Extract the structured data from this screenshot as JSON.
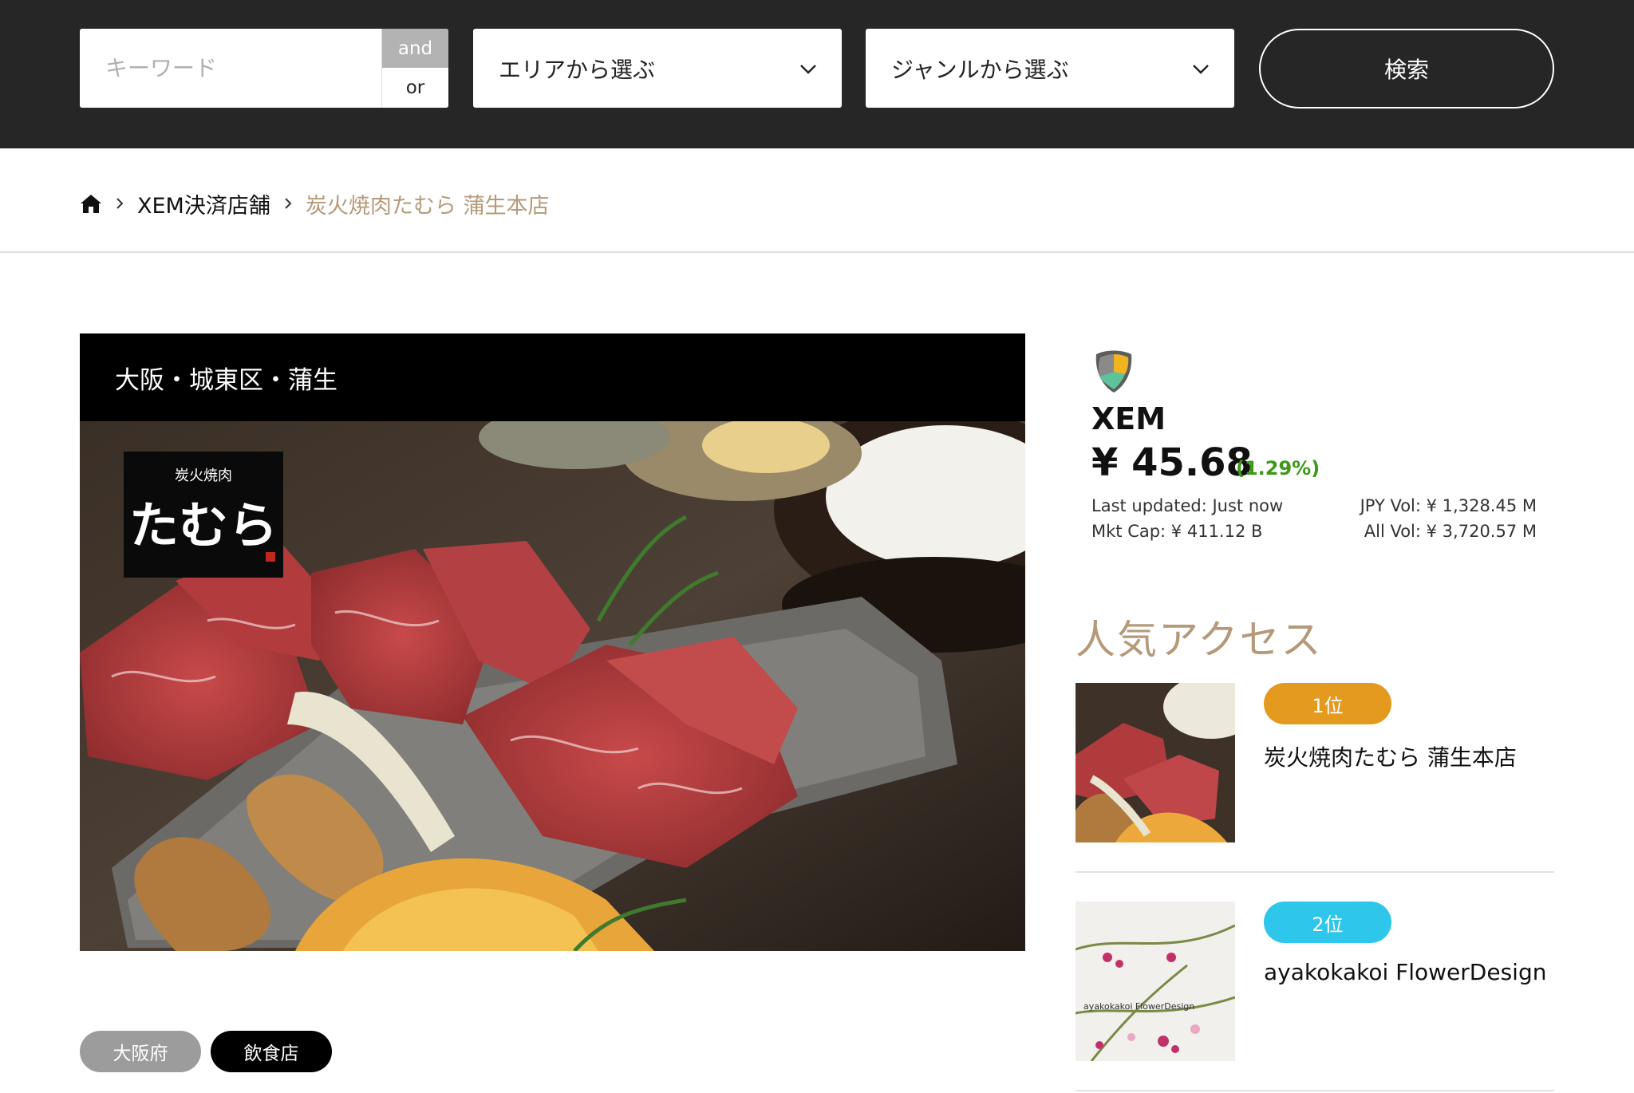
{
  "search": {
    "keyword_placeholder": "キーワード",
    "keyword_value": "",
    "and_label": "and",
    "or_label": "or",
    "area_select": "エリアから選ぶ",
    "genre_select": "ジャンルから選ぶ",
    "search_button": "検索"
  },
  "breadcrumb": {
    "home_icon": "home-icon",
    "items": [
      "XEM決済店舗",
      "炭火焼肉たむら 蒲生本店"
    ]
  },
  "shop": {
    "region": "大阪・城東区・蒲生",
    "logo_small": "炭火焼肉",
    "logo_big": "たむら",
    "tags": [
      "大阪府",
      "飲食店"
    ]
  },
  "ticker": {
    "name": "XEM",
    "price": "¥ 45.68",
    "change": "(1.29%)",
    "change_color": "#3c9a17",
    "last_updated": "Last updated: Just now",
    "mkt_cap": "Mkt Cap: ¥ 411.12 B",
    "jpy_vol": "JPY Vol: ¥ 1,328.45 M",
    "all_vol": "All Vol: ¥ 3,720.57 M"
  },
  "popular": {
    "title": "人気アクセス",
    "items": [
      {
        "rank": "1位",
        "name": "炭火焼肉たむら 蒲生本店",
        "rank_color": "#e39a1f"
      },
      {
        "rank": "2位",
        "name": "ayakokakoi FlowerDesign",
        "rank_color": "#2ec6ea",
        "thumb_caption": "ayakokakoi FlowerDesign"
      }
    ]
  },
  "colors": {
    "header_bg": "#262626",
    "accent_beige": "#b59a7a"
  }
}
